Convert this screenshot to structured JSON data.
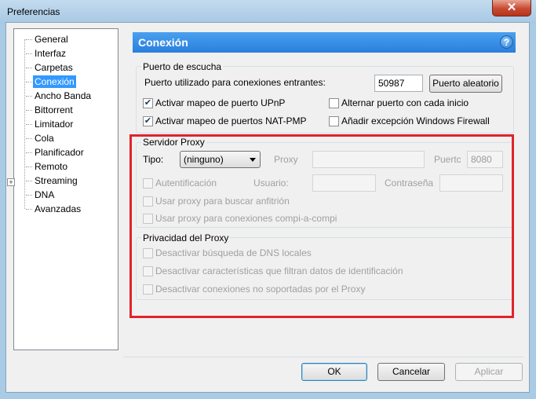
{
  "window": {
    "title": "Preferencias",
    "close_glyph": "✕"
  },
  "tree": {
    "items": [
      "General",
      "Interfaz",
      "Carpetas",
      "Conexión",
      "Ancho Banda",
      "Bittorrent",
      "Limitador",
      "Cola",
      "Planificador",
      "Remoto",
      "Streaming",
      "DNA",
      "Avanzadas"
    ],
    "selected": "Conexión",
    "expander": "+"
  },
  "header": {
    "title": "Conexión",
    "help": "?"
  },
  "listening_port": {
    "group_title": "Puerto de escucha",
    "port_label": "Puerto utilizado para conexiones entrantes:",
    "port_value": "50987",
    "random_button": "Puerto aleatorio",
    "upnp_label": "Activar mapeo de puerto UPnP",
    "upnp_checked": true,
    "natpmp_label": "Activar mapeo de puertos NAT-PMP",
    "natpmp_checked": true,
    "alternate_label": "Alternar puerto con cada inicio",
    "alternate_checked": false,
    "firewall_label": "Añadir excepción Windows Firewall",
    "firewall_checked": false
  },
  "proxy_server": {
    "group_title": "Servidor Proxy",
    "type_label": "Tipo:",
    "type_value": "(ninguno)",
    "proxy_label": "Proxy",
    "proxy_value": "",
    "port_label": "Puertc",
    "port_value": "8080",
    "auth_label": "Autentificación",
    "user_label": "Usuario:",
    "password_label": "Contraseña",
    "use_for_host_label": "Usar proxy para buscar anfitrión",
    "use_for_p2p_label": "Usar proxy para conexiones compi-a-compi"
  },
  "proxy_privacy": {
    "group_title": "Privacidad del Proxy",
    "dns_label": "Desactivar búsqueda de DNS locales",
    "leak_label": "Desactivar características que filtran datos de identificación",
    "unsupported_label": "Desactivar conexiones no soportadas por el Proxy"
  },
  "buttons": {
    "ok": "OK",
    "cancel": "Cancelar",
    "apply": "Aplicar"
  },
  "colors": {
    "selection": "#3399ff",
    "header": "#2a7fdd",
    "highlight_box": "#e0242b"
  },
  "icons": {
    "help": "help-icon",
    "close": "close-icon",
    "dropdown": "chevron-down-icon"
  }
}
